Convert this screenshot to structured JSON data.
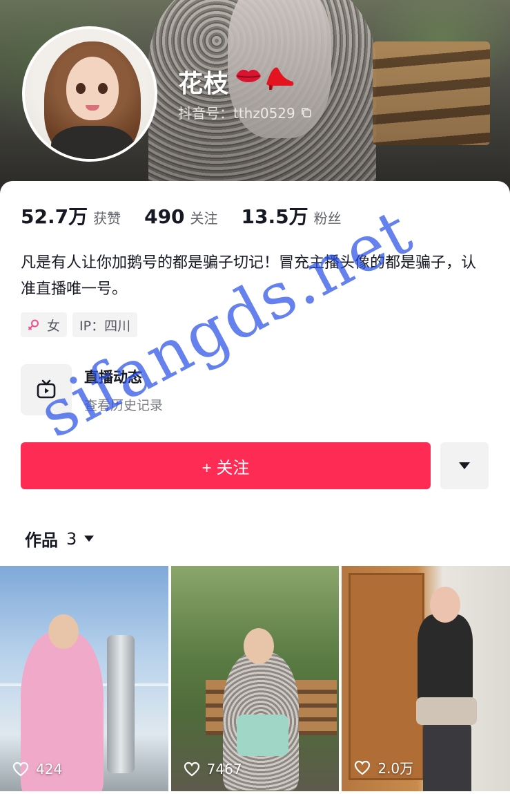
{
  "profile": {
    "nickname": "花枝",
    "nickname_emoji": [
      "lips-icon",
      "high-heel-icon"
    ],
    "douyin_id": "抖音号：tthz0529"
  },
  "stats": [
    {
      "value": "52.7万",
      "label": "获赞"
    },
    {
      "value": "490",
      "label": "关注"
    },
    {
      "value": "13.5万",
      "label": "粉丝"
    }
  ],
  "bio": "凡是有人让你加鹅号的都是骗子切记！冒充主播头像的都是骗子，认准直播唯一号。",
  "tags": {
    "gender": "女",
    "ip": "IP：四川"
  },
  "live": {
    "title": "直播动态",
    "subtitle": "查看历史记录"
  },
  "actions": {
    "follow_label": "+ 关注"
  },
  "works": {
    "label": "作品",
    "count": "3"
  },
  "videos": [
    {
      "likes": "424"
    },
    {
      "likes": "7467"
    },
    {
      "likes": "2.0万"
    }
  ],
  "watermark": "sifangds.net",
  "colors": {
    "accent": "#fe2c55",
    "watermark": "#2850e6",
    "tag_bg": "#f3f3f4"
  }
}
